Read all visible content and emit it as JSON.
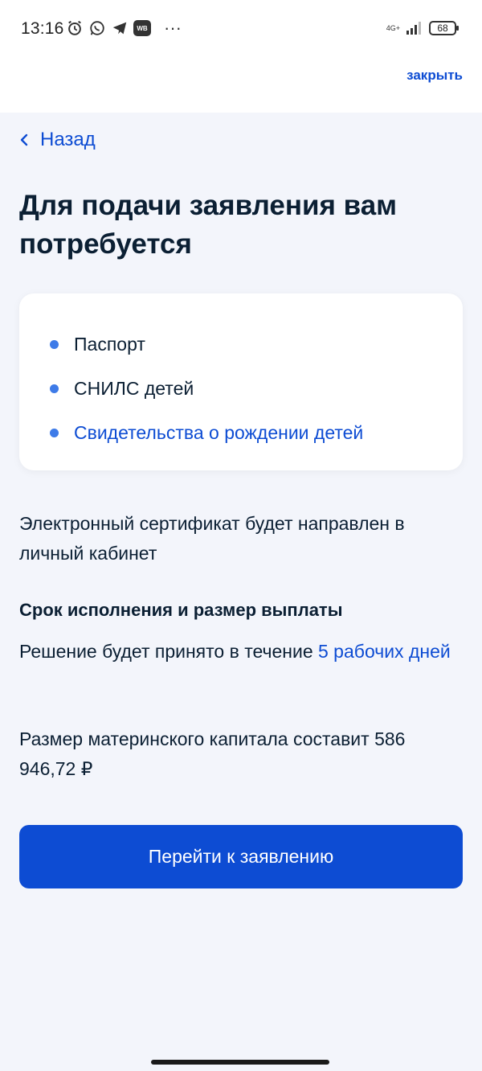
{
  "status_bar": {
    "time": "13:16",
    "network": "4G+",
    "battery": "68",
    "wb_label": "WB",
    "more": "···"
  },
  "header": {
    "close_label": "закрыть"
  },
  "nav": {
    "back_label": "Назад"
  },
  "title": "Для подачи заявления вам потребуется",
  "documents": [
    {
      "label": "Паспорт",
      "is_link": false
    },
    {
      "label": "СНИЛС детей",
      "is_link": false
    },
    {
      "label": "Свидетельства о рождении детей",
      "is_link": true
    }
  ],
  "info": {
    "certificate_text": "Электронный сертификат будет направлен в личный кабинет",
    "terms_heading": "Срок исполнения и размер выплаты",
    "decision_prefix": "Решение будет принято в течение ",
    "decision_period": "5 рабочих дней",
    "capital_text": "Размер материнского капитала составит 586 946,72 ₽"
  },
  "actions": {
    "primary_label": "Перейти к заявлению"
  },
  "colors": {
    "accent": "#0d4cd3",
    "bullet": "#3e7be8",
    "background": "#f3f5fb",
    "text": "#0b1f33"
  }
}
